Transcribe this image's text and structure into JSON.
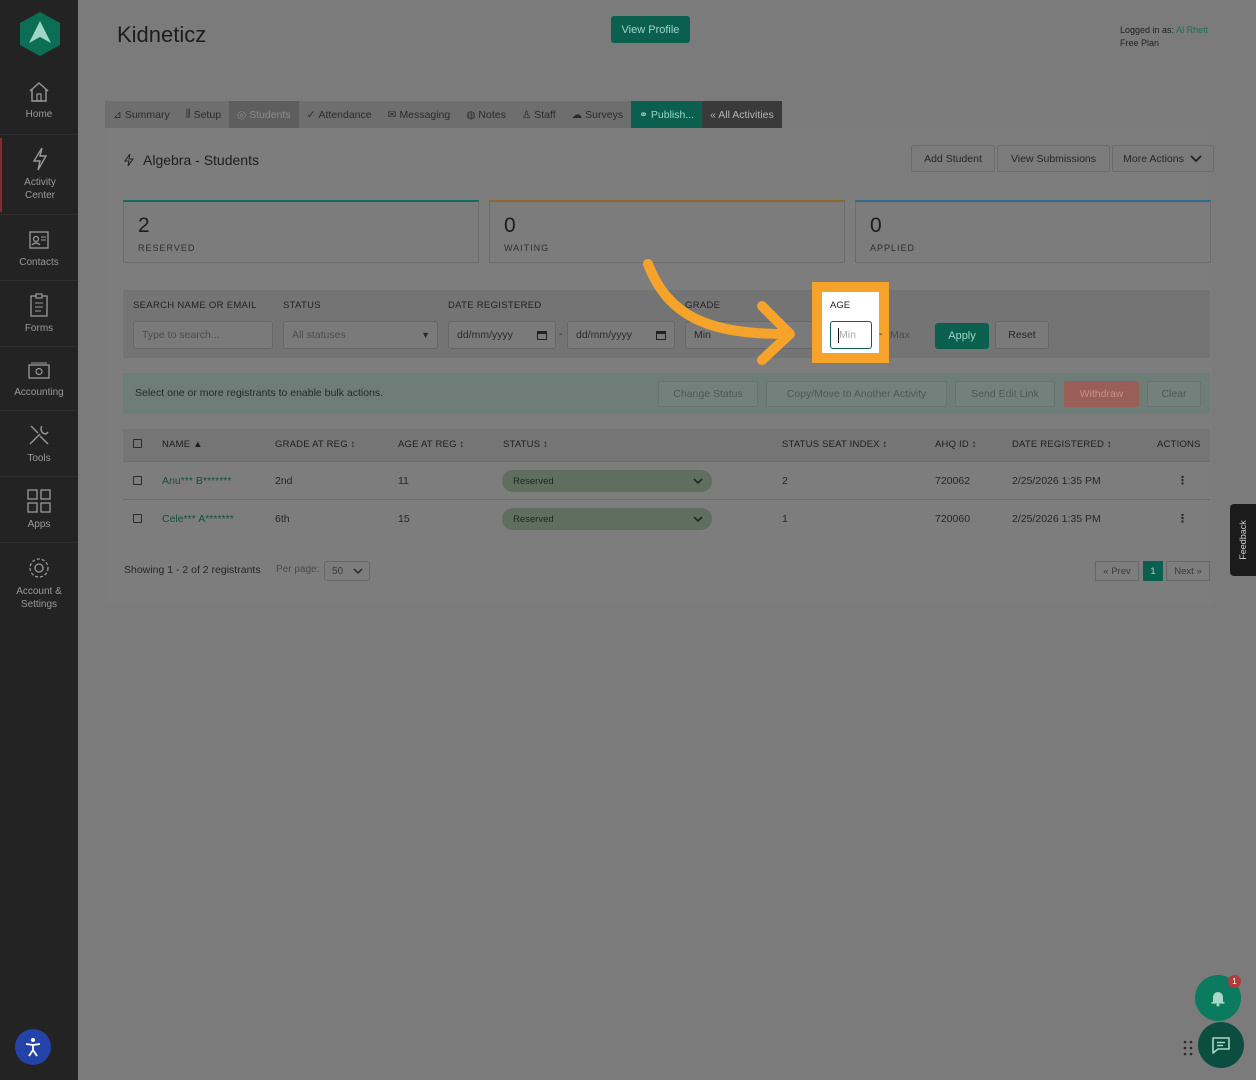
{
  "sidebar": {
    "items": [
      {
        "label": "Home",
        "icon": "home-icon"
      },
      {
        "label": "Activity Center",
        "icon": "lightning-icon"
      },
      {
        "label": "Contacts",
        "icon": "contacts-icon"
      },
      {
        "label": "Forms",
        "icon": "forms-icon"
      },
      {
        "label": "Accounting",
        "icon": "accounting-icon"
      },
      {
        "label": "Tools",
        "icon": "tools-icon"
      },
      {
        "label": "Apps",
        "icon": "apps-icon"
      },
      {
        "label": "Account & Settings",
        "icon": "gear-icon"
      }
    ]
  },
  "header": {
    "title": "Kidneticz",
    "view_profile": "View Profile",
    "logged_in_prefix": "Logged in as:",
    "user_name": "Al Rhett",
    "plan": "Free Plan"
  },
  "tabs": [
    {
      "label": "Summary"
    },
    {
      "label": "Setup"
    },
    {
      "label": "Students"
    },
    {
      "label": "Attendance"
    },
    {
      "label": "Messaging"
    },
    {
      "label": "Notes"
    },
    {
      "label": "Staff"
    },
    {
      "label": "Surveys"
    },
    {
      "label": "Publish..."
    },
    {
      "label": "« All Activities"
    }
  ],
  "page": {
    "title": "Algebra - Students",
    "add_student": "Add Student",
    "view_submissions": "View Submissions",
    "more_actions": "More Actions"
  },
  "stats": [
    {
      "value": "2",
      "label": "RESERVED",
      "color": "#0f6e5a"
    },
    {
      "value": "0",
      "label": "WAITING",
      "color": "#8a6a2a"
    },
    {
      "value": "0",
      "label": "APPLIED",
      "color": "#2d6f86"
    }
  ],
  "filters": {
    "search_label": "SEARCH NAME OR EMAIL",
    "search_placeholder": "Type to search...",
    "status_label": "STATUS",
    "status_value": "All statuses",
    "date_label": "DATE REGISTERED",
    "date_from": "dd/mm/yyyy",
    "date_to": "dd/mm/yyyy",
    "date_sep": "-",
    "grade_label": "GRADE",
    "grade_min": "Min",
    "age_label": "AGE",
    "age_min": "Min",
    "age_sep": "-",
    "age_max": "Max",
    "apply": "Apply",
    "reset": "Reset"
  },
  "bulk": {
    "message": "Select one or more registrants to enable bulk actions.",
    "change_status": "Change Status",
    "copy_move": "Copy/Move to Another Activity",
    "send_edit_link": "Send Edit Link",
    "withdraw": "Withdraw",
    "clear": "Clear"
  },
  "table": {
    "columns": [
      "NAME ▲",
      "GRADE AT REG ↕",
      "AGE AT REG ↕",
      "STATUS ↕",
      "STATUS SEAT INDEX ↕",
      "AHQ ID ↕",
      "DATE REGISTERED ↕",
      "ACTIONS"
    ],
    "rows": [
      {
        "name": "Anu*** B*******",
        "grade": "2nd",
        "age": "11",
        "status": "Reserved",
        "seat": "2",
        "ahq": "720062",
        "date": "2/25/2026 1:35 PM",
        "actions": "⋮"
      },
      {
        "name": "Cele*** A*******",
        "grade": "6th",
        "age": "15",
        "status": "Reserved",
        "seat": "1",
        "ahq": "720060",
        "date": "2/25/2026 1:35 PM",
        "actions": "⋮"
      }
    ]
  },
  "footer": {
    "showing": "Showing 1 - 2 of 2 registrants",
    "per_page_label": "Per page:",
    "per_page": "50",
    "prev": "« Prev",
    "current": "1",
    "next": "Next »"
  },
  "widgets": {
    "feedback": "Feedback",
    "notification_count": "1"
  },
  "colors": {
    "brand_green": "#0b5f4e",
    "highlight_orange": "#f5a32a",
    "sidebar_bg": "#232323"
  }
}
